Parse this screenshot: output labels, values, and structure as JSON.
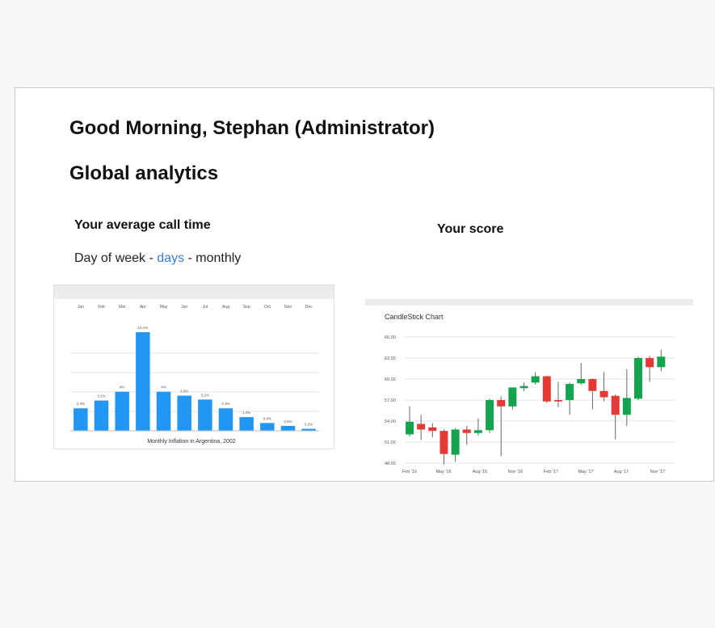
{
  "greeting": "Good Morning,  Stephan (Administrator)",
  "section_title": "Global analytics",
  "call_time": {
    "title": "Your average call time",
    "filters": {
      "prefix": "Day of week - ",
      "active": "days",
      "sep": " - ",
      "suffix": "monthly"
    }
  },
  "score": {
    "title": "Your score"
  },
  "colors": {
    "link": "#3b7ddd",
    "bar": "#2196f3",
    "up": "#14a44d",
    "down": "#e53935"
  },
  "chart_data": [
    {
      "type": "bar",
      "title": "Monthly Inflation in Argentina, 2002",
      "categories": [
        "Jan",
        "Feb",
        "Mar",
        "Apr",
        "May",
        "Jun",
        "Jul",
        "Aug",
        "Sep",
        "Oct",
        "Nov",
        "Dec"
      ],
      "values": [
        2.3,
        3.1,
        4,
        10.1,
        4,
        3.6,
        3.2,
        2.3,
        1.4,
        0.8,
        0.5,
        0.2
      ],
      "labels": [
        "2.3%",
        "3.1%",
        "4%",
        "10.1%",
        "4%",
        "3.6%",
        "3.2%",
        "2.3%",
        "1.4%",
        "0.8%",
        "0.5%",
        "0.2%"
      ],
      "ylim": [
        0,
        10.1
      ],
      "grid": true,
      "legend": "none"
    },
    {
      "type": "candlestick",
      "title": "CandleStick Chart",
      "ylim": [
        48,
        66
      ],
      "yticks": [
        "66.00",
        "63.00",
        "60.00",
        "57.00",
        "54.00",
        "51.00",
        "48.00"
      ],
      "xticks": [
        "Feb '16",
        "May '16",
        "Aug '16",
        "Nov '16",
        "Feb '17",
        "May '17",
        "Aug '17",
        "Nov '17"
      ],
      "grid": true,
      "candles": [
        {
          "o": 52.1,
          "h": 56.1,
          "l": 51.8,
          "c": 53.9
        },
        {
          "o": 53.6,
          "h": 54.9,
          "l": 51.3,
          "c": 52.8
        },
        {
          "o": 53.1,
          "h": 53.7,
          "l": 51.7,
          "c": 52.6
        },
        {
          "o": 52.6,
          "h": 52.8,
          "l": 47.8,
          "c": 49.3
        },
        {
          "o": 49.2,
          "h": 53.0,
          "l": 48.2,
          "c": 52.8
        },
        {
          "o": 52.8,
          "h": 53.3,
          "l": 50.6,
          "c": 52.3
        },
        {
          "o": 52.3,
          "h": 54.4,
          "l": 51.9,
          "c": 52.7
        },
        {
          "o": 52.7,
          "h": 57.2,
          "l": 52.3,
          "c": 57.0
        },
        {
          "o": 57.0,
          "h": 57.5,
          "l": 49.0,
          "c": 56.1
        },
        {
          "o": 56.1,
          "h": 58.8,
          "l": 55.7,
          "c": 58.8
        },
        {
          "o": 58.7,
          "h": 59.5,
          "l": 58.3,
          "c": 59.0
        },
        {
          "o": 59.5,
          "h": 61.0,
          "l": 59.2,
          "c": 60.4
        },
        {
          "o": 60.4,
          "h": 60.5,
          "l": 56.6,
          "c": 56.8
        },
        {
          "o": 57.0,
          "h": 59.6,
          "l": 56.0,
          "c": 56.8
        },
        {
          "o": 57.0,
          "h": 59.5,
          "l": 54.9,
          "c": 59.3
        },
        {
          "o": 59.4,
          "h": 62.3,
          "l": 59.2,
          "c": 60.0
        },
        {
          "o": 60.0,
          "h": 60.1,
          "l": 55.7,
          "c": 58.3
        },
        {
          "o": 58.3,
          "h": 61.0,
          "l": 56.8,
          "c": 57.4
        },
        {
          "o": 57.6,
          "h": 57.8,
          "l": 51.4,
          "c": 54.9
        },
        {
          "o": 54.9,
          "h": 61.4,
          "l": 53.3,
          "c": 57.3
        },
        {
          "o": 57.2,
          "h": 63.2,
          "l": 57.0,
          "c": 63.0
        },
        {
          "o": 63.0,
          "h": 63.3,
          "l": 59.6,
          "c": 61.7
        },
        {
          "o": 61.7,
          "h": 64.2,
          "l": 61.1,
          "c": 63.2
        }
      ]
    }
  ]
}
